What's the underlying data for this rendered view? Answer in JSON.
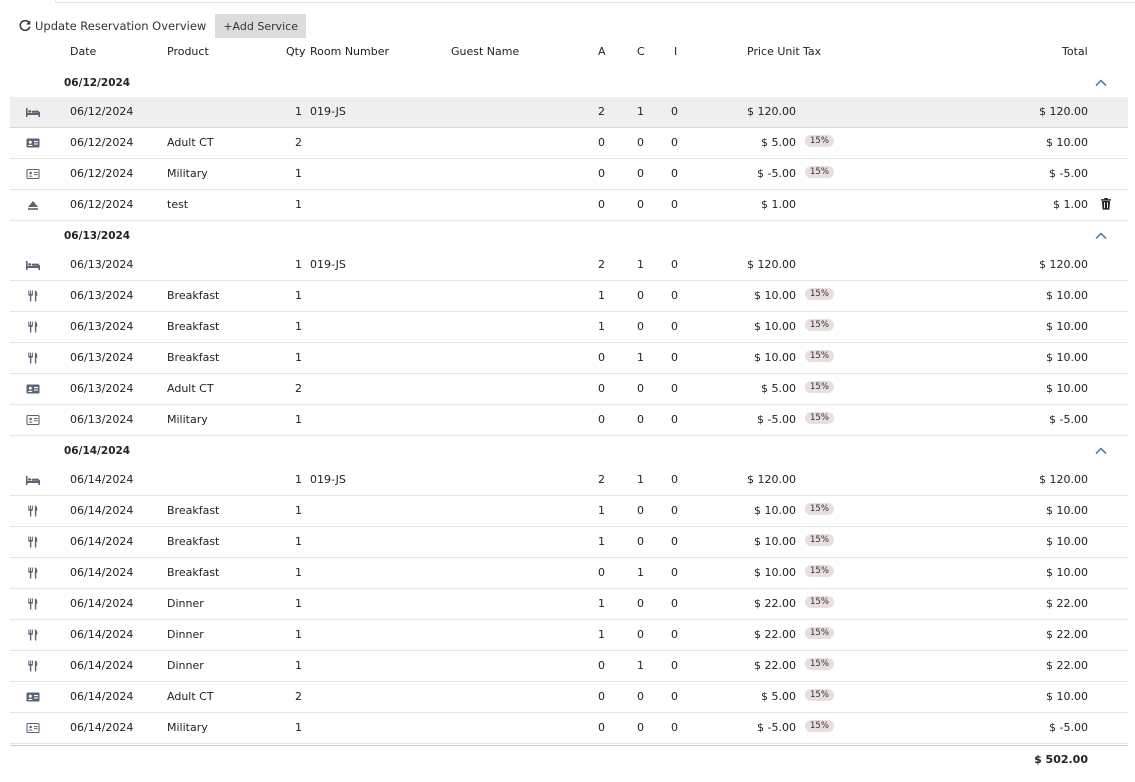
{
  "toolbar": {
    "update_label": "Update Reservation Overview",
    "add_label": "+Add Service"
  },
  "columns": {
    "date": "Date",
    "product": "Product",
    "qty": "Qty",
    "room": "Room Number",
    "guest": "Guest Name",
    "a": "A",
    "c": "C",
    "i": "I",
    "price": "Price Unit",
    "tax": "Tax",
    "total": "Total"
  },
  "groups": [
    {
      "date": "06/12/2024",
      "rows": [
        {
          "icon": "bed-icon",
          "date": "06/12/2024",
          "product": "",
          "qty": "1",
          "room": "019-JS",
          "a": "2",
          "c": "1",
          "i": "0",
          "price": "$ 120.00",
          "tax": "",
          "total": "$ 120.00",
          "highlight": true
        },
        {
          "icon": "id-card-icon",
          "date": "06/12/2024",
          "product": "Adult CT",
          "qty": "2",
          "room": "",
          "a": "0",
          "c": "0",
          "i": "0",
          "price": "$ 5.00",
          "tax": "15%",
          "total": "$ 10.00"
        },
        {
          "icon": "contact-card-icon",
          "date": "06/12/2024",
          "product": "Military",
          "qty": "1",
          "room": "",
          "a": "0",
          "c": "0",
          "i": "0",
          "price": "$ -5.00",
          "tax": "15%",
          "total": "$ -5.00"
        },
        {
          "icon": "eject-icon",
          "date": "06/12/2024",
          "product": "test",
          "qty": "1",
          "room": "",
          "a": "0",
          "c": "0",
          "i": "0",
          "price": "$ 1.00",
          "tax": "",
          "total": "$ 1.00",
          "deletable": true
        }
      ]
    },
    {
      "date": "06/13/2024",
      "rows": [
        {
          "icon": "bed-icon",
          "date": "06/13/2024",
          "product": "",
          "qty": "1",
          "room": "019-JS",
          "a": "2",
          "c": "1",
          "i": "0",
          "price": "$ 120.00",
          "tax": "",
          "total": "$ 120.00"
        },
        {
          "icon": "utensils-icon",
          "date": "06/13/2024",
          "product": "Breakfast",
          "qty": "1",
          "room": "",
          "a": "1",
          "c": "0",
          "i": "0",
          "price": "$ 10.00",
          "tax": "15%",
          "total": "$ 10.00"
        },
        {
          "icon": "utensils-icon",
          "date": "06/13/2024",
          "product": "Breakfast",
          "qty": "1",
          "room": "",
          "a": "1",
          "c": "0",
          "i": "0",
          "price": "$ 10.00",
          "tax": "15%",
          "total": "$ 10.00"
        },
        {
          "icon": "utensils-icon",
          "date": "06/13/2024",
          "product": "Breakfast",
          "qty": "1",
          "room": "",
          "a": "0",
          "c": "1",
          "i": "0",
          "price": "$ 10.00",
          "tax": "15%",
          "total": "$ 10.00"
        },
        {
          "icon": "id-card-icon",
          "date": "06/13/2024",
          "product": "Adult CT",
          "qty": "2",
          "room": "",
          "a": "0",
          "c": "0",
          "i": "0",
          "price": "$ 5.00",
          "tax": "15%",
          "total": "$ 10.00"
        },
        {
          "icon": "contact-card-icon",
          "date": "06/13/2024",
          "product": "Military",
          "qty": "1",
          "room": "",
          "a": "0",
          "c": "0",
          "i": "0",
          "price": "$ -5.00",
          "tax": "15%",
          "total": "$ -5.00"
        }
      ]
    },
    {
      "date": "06/14/2024",
      "rows": [
        {
          "icon": "bed-icon",
          "date": "06/14/2024",
          "product": "",
          "qty": "1",
          "room": "019-JS",
          "a": "2",
          "c": "1",
          "i": "0",
          "price": "$ 120.00",
          "tax": "",
          "total": "$ 120.00"
        },
        {
          "icon": "utensils-icon",
          "date": "06/14/2024",
          "product": "Breakfast",
          "qty": "1",
          "room": "",
          "a": "1",
          "c": "0",
          "i": "0",
          "price": "$ 10.00",
          "tax": "15%",
          "total": "$ 10.00"
        },
        {
          "icon": "utensils-icon",
          "date": "06/14/2024",
          "product": "Breakfast",
          "qty": "1",
          "room": "",
          "a": "1",
          "c": "0",
          "i": "0",
          "price": "$ 10.00",
          "tax": "15%",
          "total": "$ 10.00"
        },
        {
          "icon": "utensils-icon",
          "date": "06/14/2024",
          "product": "Breakfast",
          "qty": "1",
          "room": "",
          "a": "0",
          "c": "1",
          "i": "0",
          "price": "$ 10.00",
          "tax": "15%",
          "total": "$ 10.00"
        },
        {
          "icon": "utensils-icon",
          "date": "06/14/2024",
          "product": "Dinner",
          "qty": "1",
          "room": "",
          "a": "1",
          "c": "0",
          "i": "0",
          "price": "$ 22.00",
          "tax": "15%",
          "total": "$ 22.00"
        },
        {
          "icon": "utensils-icon",
          "date": "06/14/2024",
          "product": "Dinner",
          "qty": "1",
          "room": "",
          "a": "1",
          "c": "0",
          "i": "0",
          "price": "$ 22.00",
          "tax": "15%",
          "total": "$ 22.00"
        },
        {
          "icon": "utensils-icon",
          "date": "06/14/2024",
          "product": "Dinner",
          "qty": "1",
          "room": "",
          "a": "0",
          "c": "1",
          "i": "0",
          "price": "$ 22.00",
          "tax": "15%",
          "total": "$ 22.00"
        },
        {
          "icon": "id-card-icon",
          "date": "06/14/2024",
          "product": "Adult CT",
          "qty": "2",
          "room": "",
          "a": "0",
          "c": "0",
          "i": "0",
          "price": "$ 5.00",
          "tax": "15%",
          "total": "$ 10.00"
        },
        {
          "icon": "contact-card-icon",
          "date": "06/14/2024",
          "product": "Military",
          "qty": "1",
          "room": "",
          "a": "0",
          "c": "0",
          "i": "0",
          "price": "$ -5.00",
          "tax": "15%",
          "total": "$ -5.00"
        }
      ]
    }
  ],
  "grand_total": "$ 502.00",
  "colors": {
    "icon": "#5a6475",
    "chevron": "#3f6d96",
    "tax_badge": "#e9dede",
    "button_bg": "#dcdcdc",
    "highlight_row": "#efefef"
  }
}
